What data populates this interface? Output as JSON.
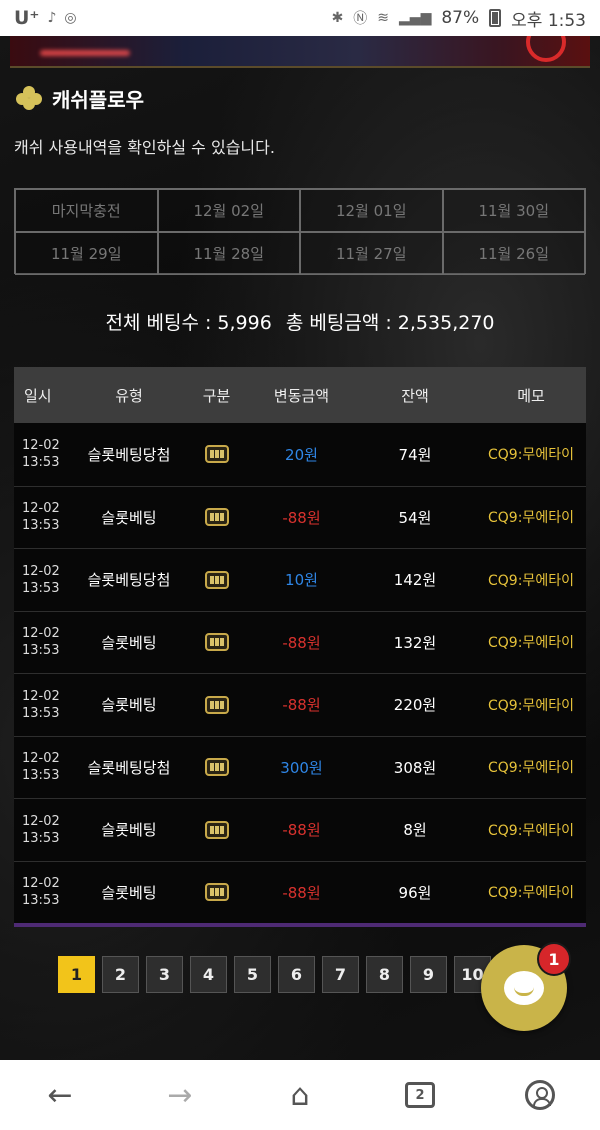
{
  "status_bar": {
    "carrier": "U⁺",
    "battery": "87%",
    "time": "오후 1:53"
  },
  "header": {
    "title": "캐쉬플로우",
    "description": "캐쉬 사용내역을 확인하실 수 있습니다."
  },
  "date_filters": [
    "마지막충전",
    "12월 02일",
    "12월 01일",
    "11월 30일",
    "11월 29일",
    "11월 28일",
    "11월 27일",
    "11월 26일"
  ],
  "totals": {
    "bet_count_label": "전체 베팅수 : 5,996",
    "bet_amount_label": "총 베팅금액 : 2,535,270"
  },
  "table": {
    "headers": [
      "일시",
      "유형",
      "구분",
      "변동금액",
      "잔액",
      "메모"
    ],
    "rows": [
      {
        "date": "12-02",
        "time": "13:53",
        "type": "슬롯베팅당첨",
        "amount": "20원",
        "sign": "pos",
        "balance": "74원",
        "memo": "CQ9:무에타이"
      },
      {
        "date": "12-02",
        "time": "13:53",
        "type": "슬롯베팅",
        "amount": "-88원",
        "sign": "neg",
        "balance": "54원",
        "memo": "CQ9:무에타이"
      },
      {
        "date": "12-02",
        "time": "13:53",
        "type": "슬롯베팅당첨",
        "amount": "10원",
        "sign": "pos",
        "balance": "142원",
        "memo": "CQ9:무에타이"
      },
      {
        "date": "12-02",
        "time": "13:53",
        "type": "슬롯베팅",
        "amount": "-88원",
        "sign": "neg",
        "balance": "132원",
        "memo": "CQ9:무에타이"
      },
      {
        "date": "12-02",
        "time": "13:53",
        "type": "슬롯베팅",
        "amount": "-88원",
        "sign": "neg",
        "balance": "220원",
        "memo": "CQ9:무에타이"
      },
      {
        "date": "12-02",
        "time": "13:53",
        "type": "슬롯베팅당첨",
        "amount": "300원",
        "sign": "pos",
        "balance": "308원",
        "memo": "CQ9:무에타이"
      },
      {
        "date": "12-02",
        "time": "13:53",
        "type": "슬롯베팅",
        "amount": "-88원",
        "sign": "neg",
        "balance": "8원",
        "memo": "CQ9:무에타이"
      },
      {
        "date": "12-02",
        "time": "13:53",
        "type": "슬롯베팅",
        "amount": "-88원",
        "sign": "neg",
        "balance": "96원",
        "memo": "CQ9:무에타이"
      }
    ]
  },
  "pagination": {
    "pages": [
      "1",
      "2",
      "3",
      "4",
      "5",
      "6",
      "7",
      "8",
      "9",
      "10"
    ],
    "active": "1"
  },
  "chat": {
    "icon": "chat-bubble-icon",
    "badge_count": "1"
  },
  "bottom_nav": {
    "tab_count": "2",
    "icons": [
      "back-arrow-icon",
      "forward-arrow-icon",
      "home-icon",
      "tabs-icon",
      "profile-icon"
    ]
  },
  "colors": {
    "positive": "#2f86e6",
    "negative": "#d8322e",
    "memo": "#e6c23a",
    "active_page": "#f2c41a",
    "chat_button": "#c9b449",
    "badge": "#d6262a"
  }
}
